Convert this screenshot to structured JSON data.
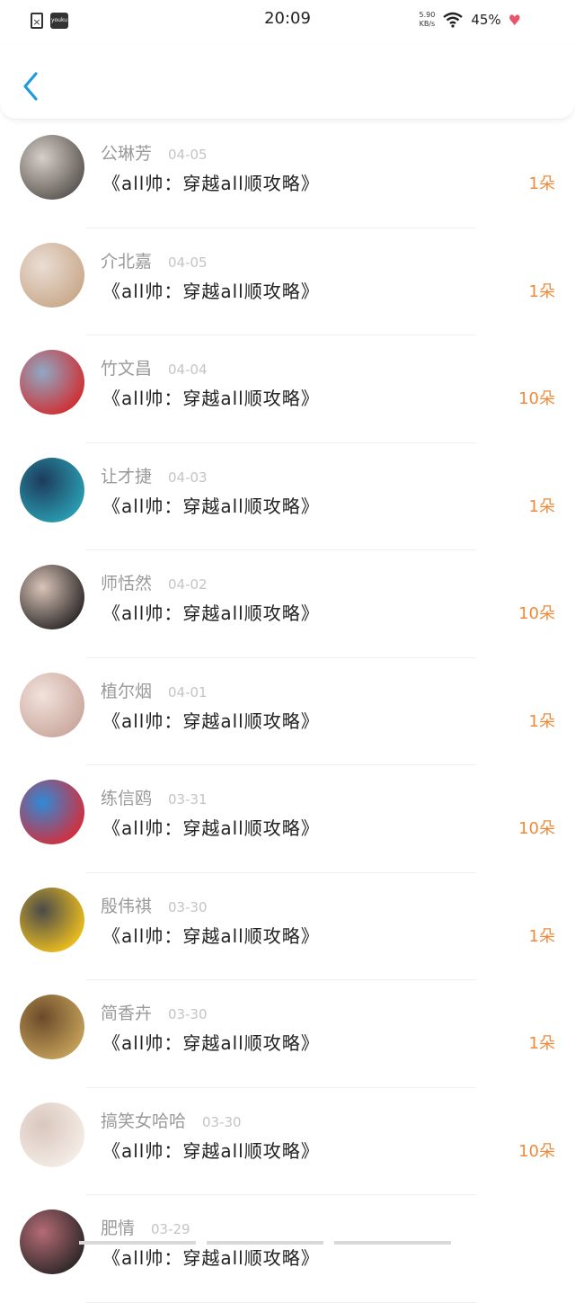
{
  "status_bar": {
    "time": "20:09",
    "speed": "5.90\nKB/s",
    "battery": "45%",
    "app_icon_text": "youku"
  },
  "nav": {
    "back_icon": "chevron-left-icon",
    "accent_color": "#1e9be0"
  },
  "items": [
    {
      "name": "公琳芳",
      "date": "04-05",
      "title": "《all帅：穿越all顺攻略》",
      "count": "1朵",
      "avatar_colors": [
        "#5a5450",
        "#d6cfc8"
      ]
    },
    {
      "name": "介北嘉",
      "date": "04-05",
      "title": "《all帅：穿越all顺攻略》",
      "count": "1朵",
      "avatar_colors": [
        "#c9a88a",
        "#e9ddd4"
      ]
    },
    {
      "name": "竹文昌",
      "date": "04-04",
      "title": "《all帅：穿越all顺攻略》",
      "count": "10朵",
      "avatar_colors": [
        "#d12b2e",
        "#8fa9c4"
      ]
    },
    {
      "name": "让才捷",
      "date": "04-03",
      "title": "《all帅：穿越all顺攻略》",
      "count": "1朵",
      "avatar_colors": [
        "#2aa1b4",
        "#1d3b5c"
      ]
    },
    {
      "name": "师恬然",
      "date": "04-02",
      "title": "《all帅：穿越all顺攻略》",
      "count": "10朵",
      "avatar_colors": [
        "#2a2626",
        "#d9c4b8"
      ]
    },
    {
      "name": "植尔烟",
      "date": "04-01",
      "title": "《all帅：穿越all顺攻略》",
      "count": "1朵",
      "avatar_colors": [
        "#caa79c",
        "#f0e2dc"
      ]
    },
    {
      "name": "练信鸥",
      "date": "03-31",
      "title": "《all帅：穿越all顺攻略》",
      "count": "10朵",
      "avatar_colors": [
        "#d92b37",
        "#2f8ad6"
      ]
    },
    {
      "name": "殷伟祺",
      "date": "03-30",
      "title": "《all帅：穿越all顺攻略》",
      "count": "1朵",
      "avatar_colors": [
        "#f2c21d",
        "#4b4b4b"
      ]
    },
    {
      "name": "简香卉",
      "date": "03-30",
      "title": "《all帅：穿越all顺攻略》",
      "count": "1朵",
      "avatar_colors": [
        "#c6a35a",
        "#6b4a2a"
      ]
    },
    {
      "name": "搞笑女哈哈",
      "date": "03-30",
      "title": "《all帅：穿越all顺攻略》",
      "count": "10朵",
      "avatar_colors": [
        "#f5ede8",
        "#d9c7bd"
      ]
    },
    {
      "name": "肥情",
      "date": "03-29",
      "title": "《all帅：穿越all顺攻略》",
      "count": "",
      "avatar_colors": [
        "#2a2626",
        "#b56b75"
      ]
    }
  ]
}
